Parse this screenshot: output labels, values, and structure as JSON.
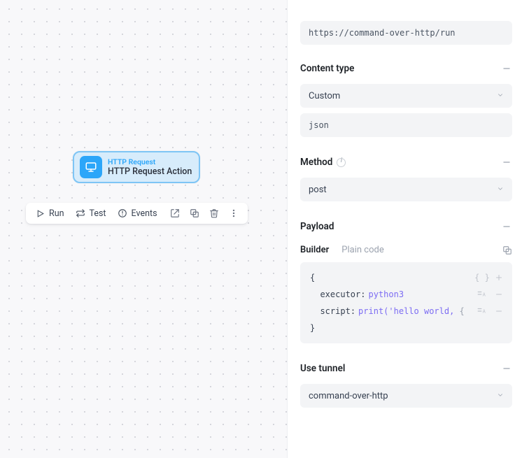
{
  "canvas": {
    "node": {
      "type_label": "HTTP Request",
      "title": "HTTP Request Action"
    },
    "toolbar": {
      "run": "Run",
      "test": "Test",
      "events": "Events"
    }
  },
  "panel": {
    "url_value": "https://command-over-http/run",
    "sections": {
      "content_type": {
        "title": "Content type",
        "select_value": "Custom",
        "subtype_value": "json"
      },
      "method": {
        "title": "Method",
        "select_value": "post"
      },
      "payload": {
        "title": "Payload",
        "tabs": {
          "builder": "Builder",
          "plain": "Plain code"
        },
        "code": {
          "open": "{",
          "row1_key": "executor",
          "row1_val": "python3",
          "row2_key": "script",
          "row2_val_a": "print('hello world,",
          "row2_val_b": " {",
          "close": "}"
        }
      },
      "tunnel": {
        "title": "Use tunnel",
        "select_value": "command-over-http"
      }
    }
  }
}
